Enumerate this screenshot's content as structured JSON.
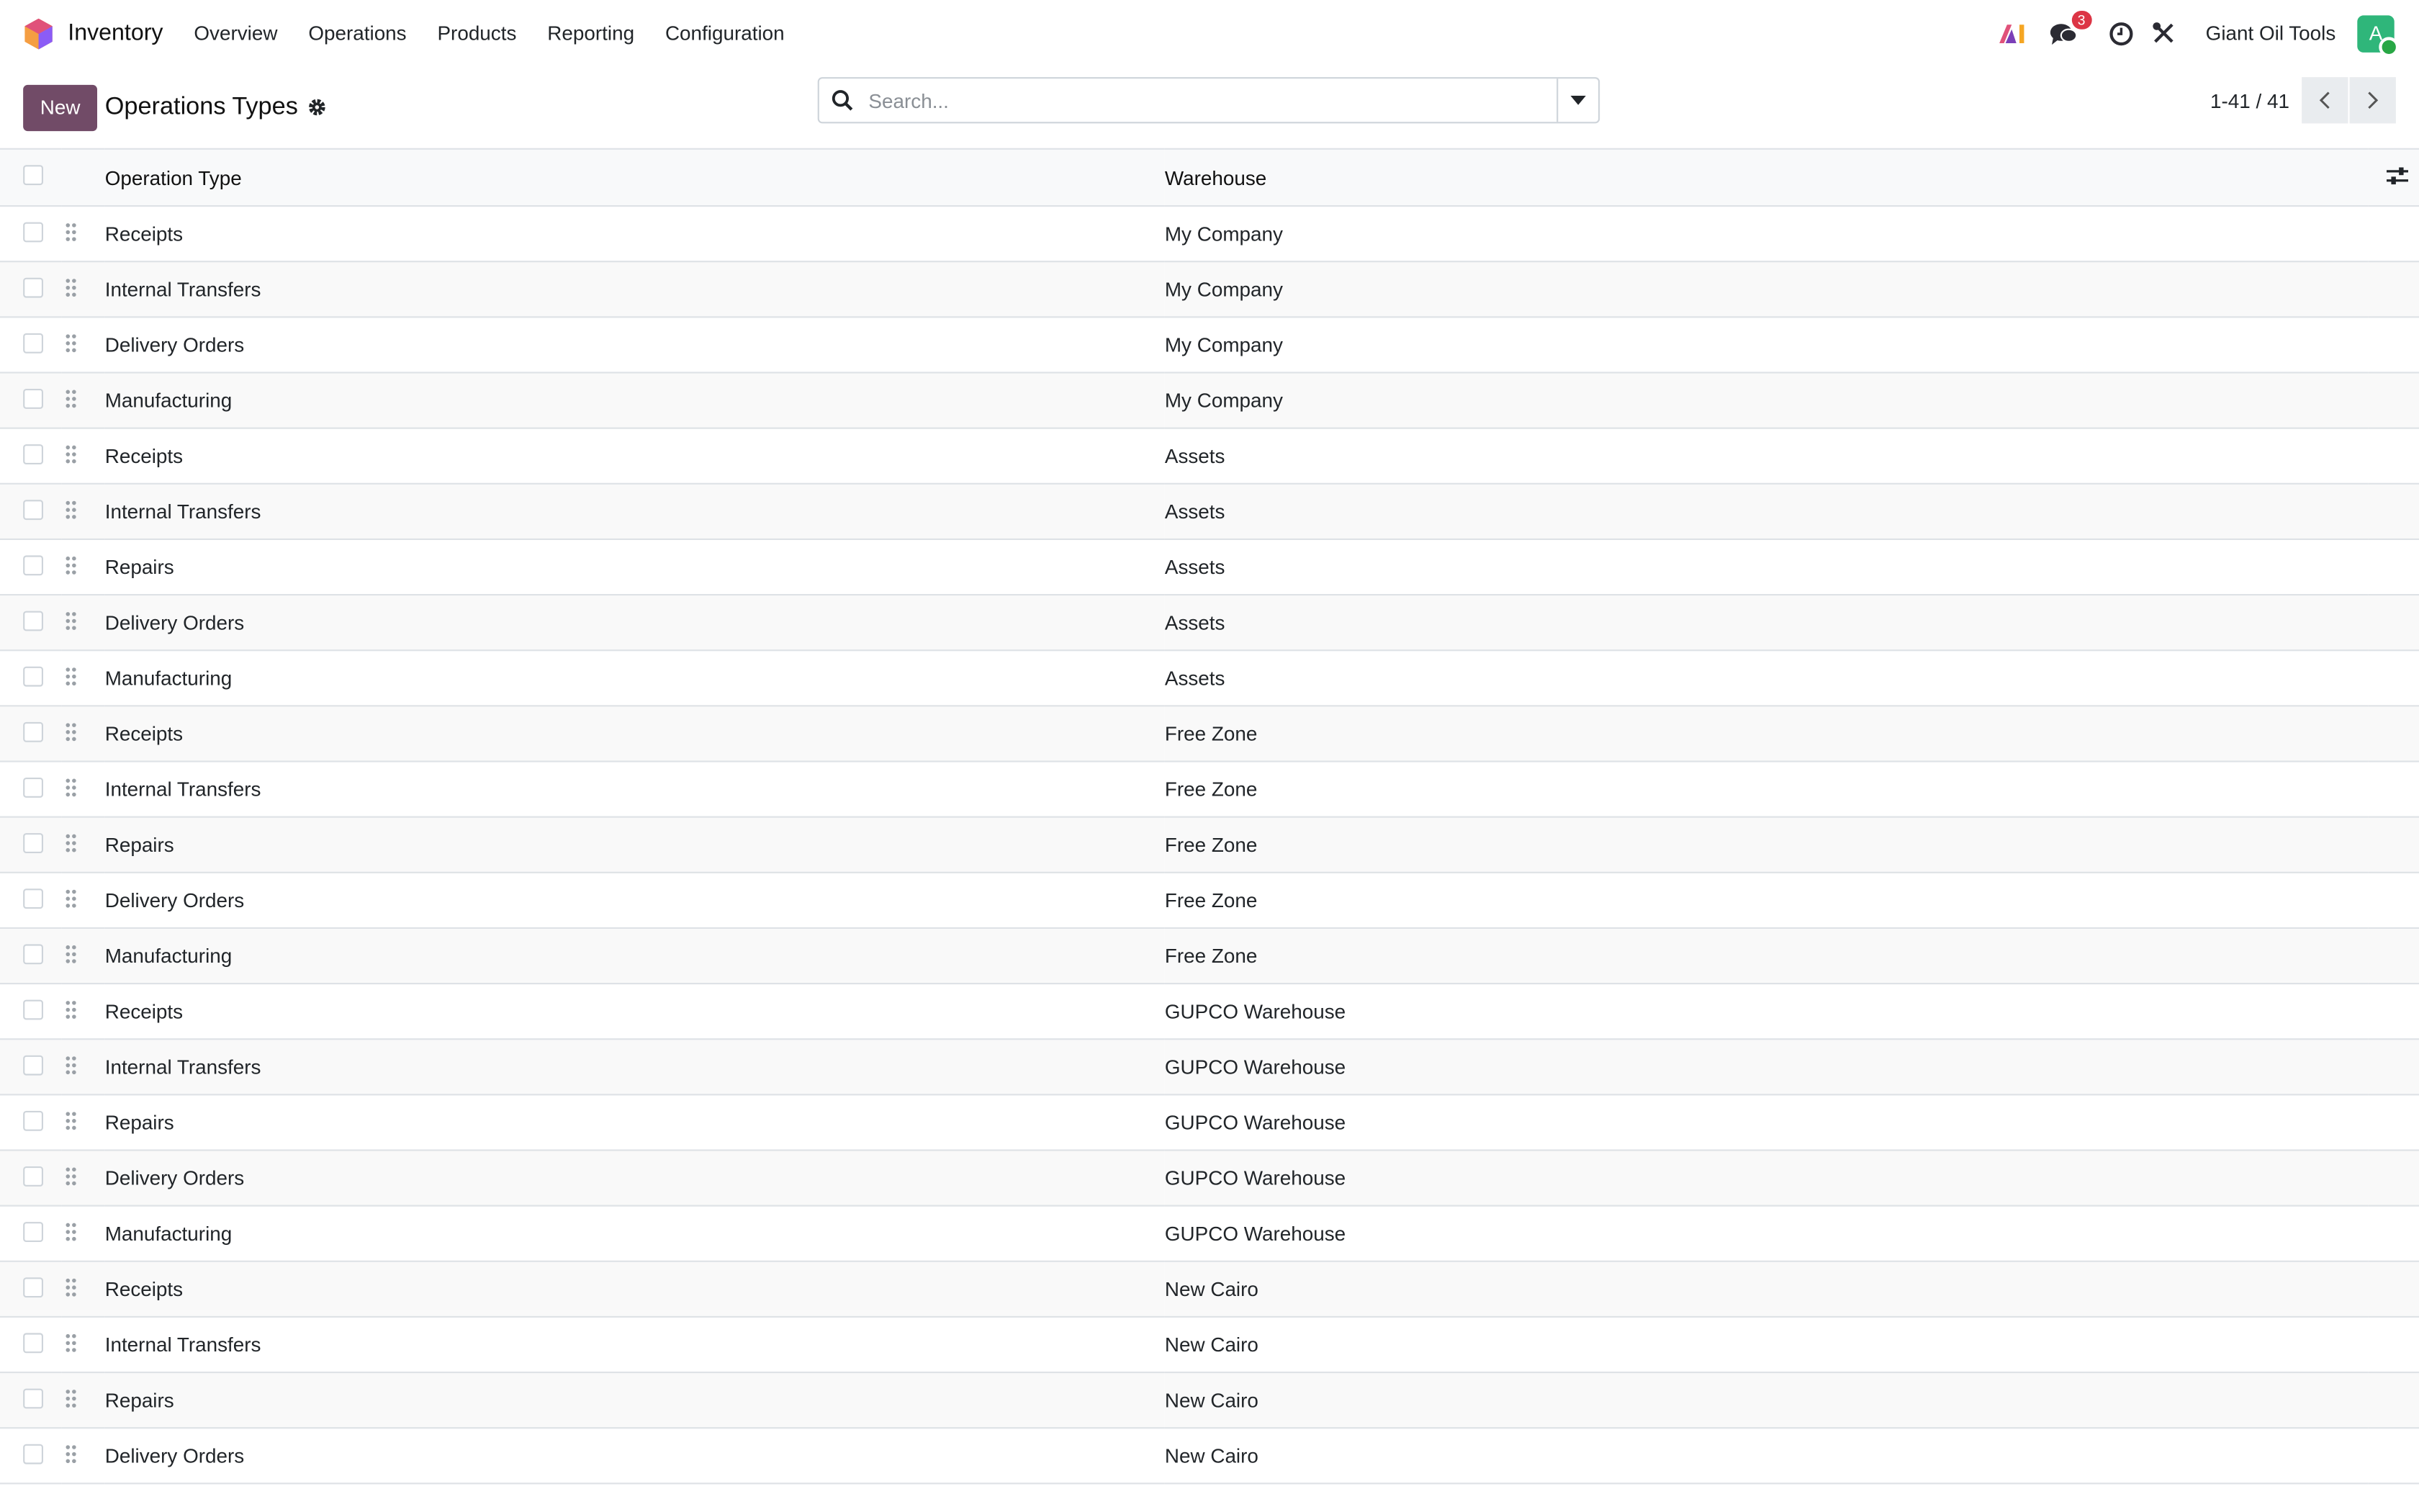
{
  "navbar": {
    "app_name": "Inventory",
    "menu": [
      "Overview",
      "Operations",
      "Products",
      "Reporting",
      "Configuration"
    ],
    "messages_count": "3",
    "company": "Giant Oil Tools",
    "avatar_letter": "A"
  },
  "control": {
    "new_label": "New",
    "title": "Operations Types",
    "search_placeholder": "Search...",
    "pager": "1-41 / 41"
  },
  "table": {
    "headers": {
      "type": "Operation Type",
      "warehouse": "Warehouse"
    },
    "rows": [
      {
        "type": "Receipts",
        "warehouse": "My Company"
      },
      {
        "type": "Internal Transfers",
        "warehouse": "My Company"
      },
      {
        "type": "Delivery Orders",
        "warehouse": "My Company"
      },
      {
        "type": "Manufacturing",
        "warehouse": "My Company"
      },
      {
        "type": "Receipts",
        "warehouse": "Assets"
      },
      {
        "type": "Internal Transfers",
        "warehouse": "Assets"
      },
      {
        "type": "Repairs",
        "warehouse": "Assets"
      },
      {
        "type": "Delivery Orders",
        "warehouse": "Assets"
      },
      {
        "type": "Manufacturing",
        "warehouse": "Assets"
      },
      {
        "type": "Receipts",
        "warehouse": "Free Zone"
      },
      {
        "type": "Internal Transfers",
        "warehouse": "Free Zone"
      },
      {
        "type": "Repairs",
        "warehouse": "Free Zone"
      },
      {
        "type": "Delivery Orders",
        "warehouse": "Free Zone"
      },
      {
        "type": "Manufacturing",
        "warehouse": "Free Zone"
      },
      {
        "type": "Receipts",
        "warehouse": "GUPCO Warehouse"
      },
      {
        "type": "Internal Transfers",
        "warehouse": "GUPCO Warehouse"
      },
      {
        "type": "Repairs",
        "warehouse": "GUPCO Warehouse"
      },
      {
        "type": "Delivery Orders",
        "warehouse": "GUPCO Warehouse"
      },
      {
        "type": "Manufacturing",
        "warehouse": "GUPCO Warehouse"
      },
      {
        "type": "Receipts",
        "warehouse": "New Cairo"
      },
      {
        "type": "Internal Transfers",
        "warehouse": "New Cairo"
      },
      {
        "type": "Repairs",
        "warehouse": "New Cairo"
      },
      {
        "type": "Delivery Orders",
        "warehouse": "New Cairo"
      }
    ]
  },
  "colors": {
    "brand": "#714b67",
    "badge": "#dc3545",
    "avatar": "#2fb67a"
  }
}
